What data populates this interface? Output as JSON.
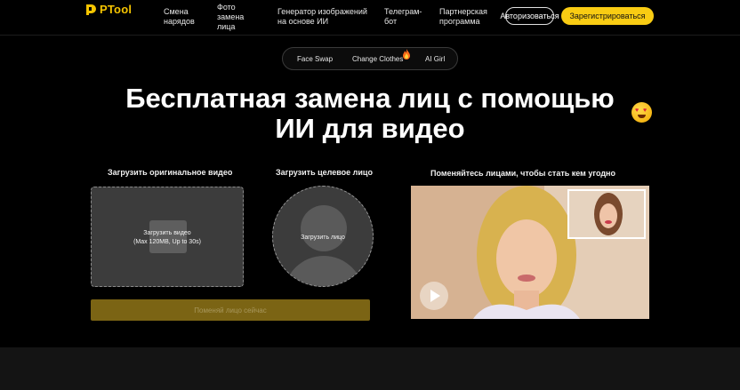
{
  "header": {
    "logo_text": "PTool",
    "nav": [
      {
        "label": "Смена нарядов"
      },
      {
        "label": "Фото замена лица"
      },
      {
        "label": "Генератор изображений на основе ИИ"
      },
      {
        "label": "Телеграм-бот"
      },
      {
        "label": "Партнерская программа"
      }
    ],
    "login_label": "Авторизоваться",
    "register_label": "Зарегистрироваться"
  },
  "tabs": [
    {
      "label": "Face Swap"
    },
    {
      "label": "Change Clothes"
    },
    {
      "label": "AI Girl"
    }
  ],
  "title": {
    "line1": "Бесплатная замена лиц с помощью",
    "line2": "ИИ для видео"
  },
  "upload": {
    "original_label": "Загрузить оригинальное видео",
    "upload_video_line1": "Загрузить видео",
    "upload_video_line2": "(Max 120MB, Up to 30s)",
    "target_label": "Загрузить целевое лицо",
    "upload_face": "Загрузить лицо",
    "swap_button": "Поменяй лицо сейчас"
  },
  "demo": {
    "caption": "Поменяйтесь лицами, чтобы стать кем угодно"
  },
  "colors": {
    "accent": "#f9cc13",
    "swap_button_bg": "#7b6414",
    "background": "#000000"
  },
  "icons": {
    "logo": "ptool-logo-icon",
    "fire": "fire-icon",
    "emoji": "heart-eyes-emoji-icon",
    "clapper": "clapperboard-icon",
    "play": "play-icon"
  }
}
